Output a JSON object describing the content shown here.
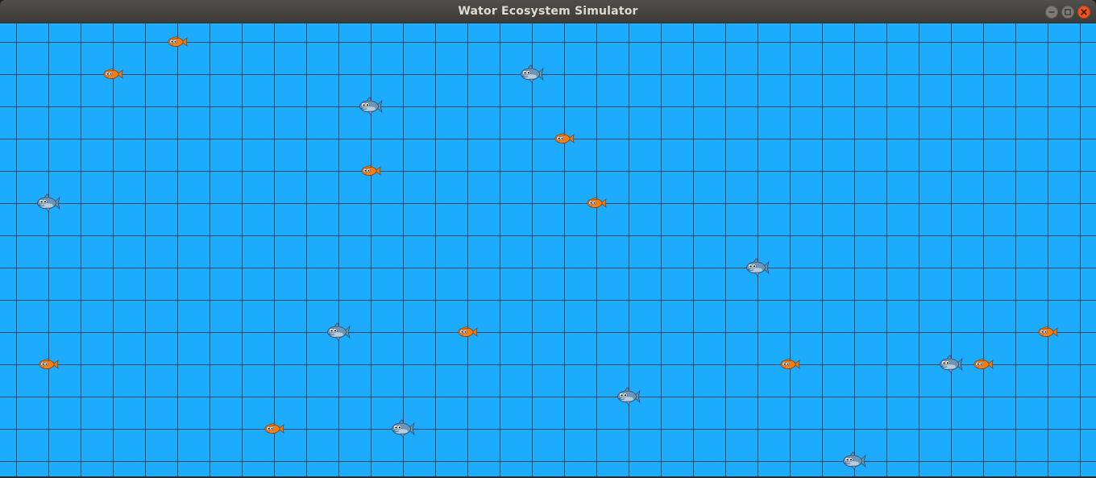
{
  "window": {
    "title": "Wator Ecosystem Simulator",
    "controls": [
      "minimize",
      "maximize",
      "close"
    ]
  },
  "colors": {
    "water": "#1dabfe",
    "grid_line": "#2a4a5c",
    "fish_body": "#f07f17",
    "shark_body": "#6a95b8",
    "close_button": "#e95420"
  },
  "grid": {
    "cols": 34,
    "rows": 14
  },
  "icons": {
    "fish": "orange-fish-icon",
    "shark": "shark-icon"
  },
  "creatures": [
    {
      "type": "fish",
      "col": 5,
      "row": 0
    },
    {
      "type": "fish",
      "col": 3,
      "row": 1
    },
    {
      "type": "shark",
      "col": 16,
      "row": 1
    },
    {
      "type": "shark",
      "col": 11,
      "row": 2
    },
    {
      "type": "fish",
      "col": 17,
      "row": 3
    },
    {
      "type": "fish",
      "col": 11,
      "row": 4
    },
    {
      "type": "shark",
      "col": 1,
      "row": 5
    },
    {
      "type": "fish",
      "col": 18,
      "row": 5
    },
    {
      "type": "shark",
      "col": 23,
      "row": 7
    },
    {
      "type": "shark",
      "col": 10,
      "row": 9
    },
    {
      "type": "fish",
      "col": 14,
      "row": 9
    },
    {
      "type": "fish",
      "col": 32,
      "row": 9
    },
    {
      "type": "fish",
      "col": 1,
      "row": 10
    },
    {
      "type": "fish",
      "col": 24,
      "row": 10
    },
    {
      "type": "shark",
      "col": 29,
      "row": 10
    },
    {
      "type": "fish",
      "col": 30,
      "row": 10
    },
    {
      "type": "shark",
      "col": 19,
      "row": 11
    },
    {
      "type": "fish",
      "col": 8,
      "row": 12
    },
    {
      "type": "shark",
      "col": 12,
      "row": 12
    },
    {
      "type": "shark",
      "col": 26,
      "row": 13
    }
  ]
}
